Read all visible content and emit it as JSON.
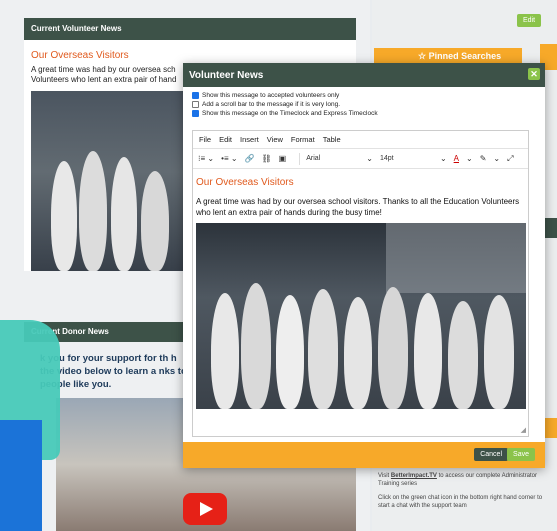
{
  "background_page": {
    "volunteer_news": {
      "header": "Current Volunteer News",
      "title": "Our Overseas Visitors",
      "text_line1": "A great time was had by our oversea sch",
      "text_line2": "Volunteers who lent an extra pair of hand"
    },
    "donor_news": {
      "header": "Current Donor News",
      "text": "k you for your support for th h the video below to learn a nks to people like you."
    },
    "right": {
      "edit_label": "Edit",
      "pinned_label": "Pinned Searches",
      "footer_line1_pre": "Visit ",
      "footer_link": "BetterImpact.TV",
      "footer_line1_post": " to access our complete Administrator Training series",
      "footer_line2": "Click on the green chat icon in the bottom right hand corner to start a chat with the support team"
    }
  },
  "modal": {
    "title": "Volunteer News",
    "close_glyph": "✕",
    "options": [
      {
        "label": "Show this message to accepted volunteers only",
        "checked": true
      },
      {
        "label": "Add a scroll bar to the message if it is very long.",
        "checked": false
      },
      {
        "label": "Show this message on the Timeclock and Express Timeclock",
        "checked": true
      }
    ],
    "menu": [
      "File",
      "Edit",
      "Insert",
      "View",
      "Format",
      "Table"
    ],
    "toolbar": {
      "font": "Arial",
      "size": "14pt"
    },
    "content": {
      "title": "Our Overseas Visitors",
      "text": "A great time was had by our oversea school visitors.  Thanks to all the Education Volunteers who lent an extra pair of hands during the busy time!"
    },
    "buttons": {
      "cancel": "Cancel",
      "save": "Save"
    }
  },
  "colors": {
    "header_green": "#3d5248",
    "accent_orange": "#f7a929",
    "button_green": "#8bc34a",
    "title_orange": "#e05a1e"
  }
}
